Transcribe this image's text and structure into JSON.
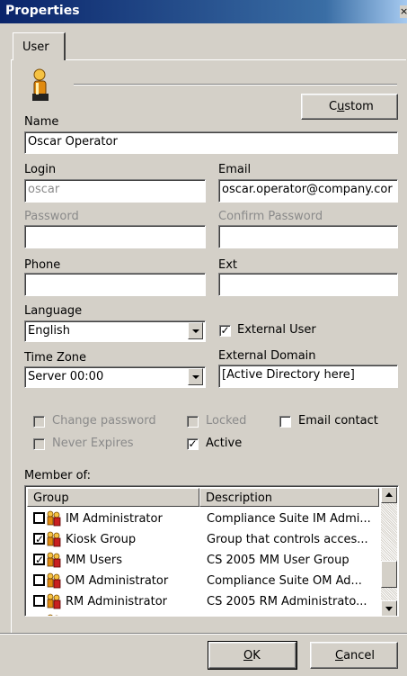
{
  "window": {
    "title": "Properties",
    "close_glyph": "×"
  },
  "tabs": [
    {
      "label": "User"
    }
  ],
  "header": {
    "user_icon": "user-icon",
    "custom_button_prefix": "C",
    "custom_button_accel": "u",
    "custom_button_suffix": "stom"
  },
  "form": {
    "name_label": "Name",
    "name_value": "Oscar Operator",
    "login_label": "Login",
    "login_value": "oscar",
    "email_label": "Email",
    "email_value": "oscar.operator@company.cor",
    "password_label": "Password",
    "password_value": "",
    "confirm_label": "Confirm Password",
    "confirm_value": "",
    "phone_label": "Phone",
    "phone_value": "",
    "ext_label": "Ext",
    "ext_value": "",
    "language_label": "Language",
    "language_value": "English",
    "external_user_label": "External User",
    "external_user_checked": true,
    "timezone_label": "Time Zone",
    "timezone_value": "Server 00:00",
    "external_domain_label": "External Domain",
    "external_domain_value": "[Active Directory here]"
  },
  "options": {
    "change_password": "Change password",
    "locked": "Locked",
    "email_contact": "Email contact",
    "never_expires": "Never Expires",
    "active": "Active",
    "active_checked": true
  },
  "members": {
    "label": "Member of:",
    "columns": [
      "Group",
      "Description"
    ],
    "rows": [
      {
        "checked": false,
        "group": "IM Administrator",
        "description": "Compliance Suite IM Admi..."
      },
      {
        "checked": true,
        "group": "Kiosk Group",
        "description": "Group that controls acces..."
      },
      {
        "checked": true,
        "group": "MM Users",
        "description": "CS 2005 MM User Group"
      },
      {
        "checked": false,
        "group": "OM Administrator",
        "description": "Compliance Suite OM Ad..."
      },
      {
        "checked": false,
        "group": "RM Administrator",
        "description": "CS 2005 RM Administrato..."
      },
      {
        "checked": false,
        "group": "...",
        "description": "..."
      }
    ]
  },
  "footer": {
    "ok_accel": "O",
    "ok_rest": "K",
    "cancel_accel": "C",
    "cancel_rest": "ancel"
  },
  "colors": {
    "titlebar": "#0a246a",
    "face": "#d4d0c8"
  }
}
